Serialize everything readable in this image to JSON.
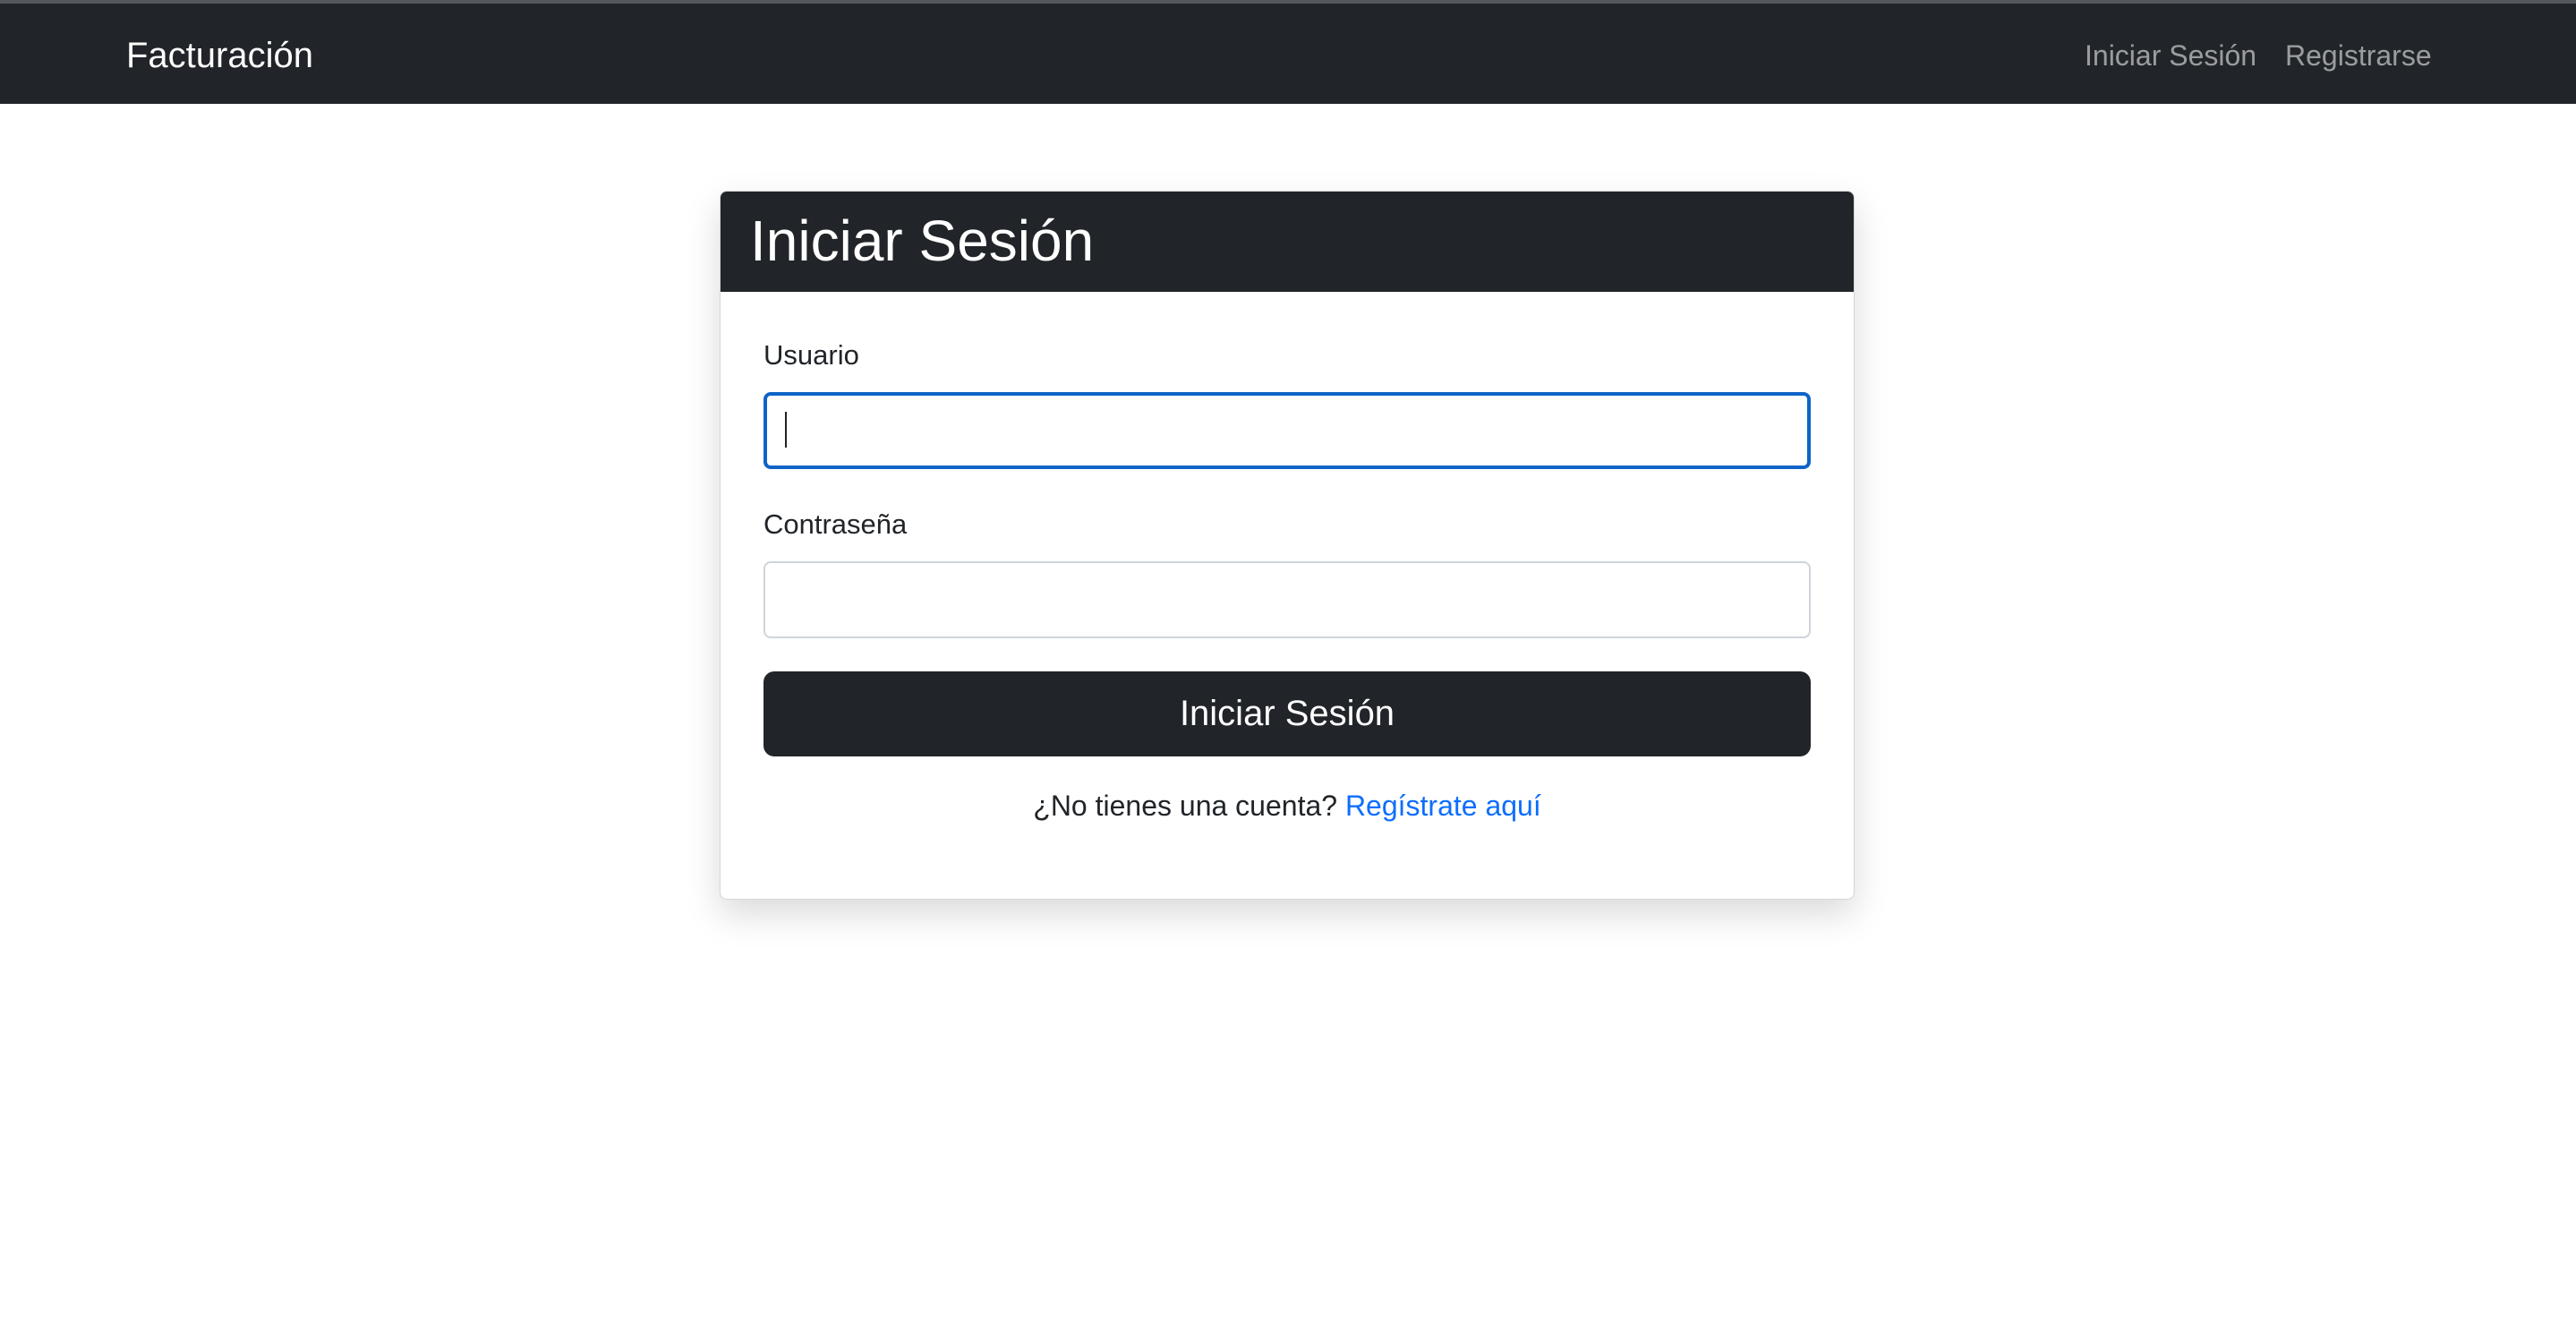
{
  "navbar": {
    "brand": "Facturación",
    "links": [
      {
        "label": "Iniciar Sesión"
      },
      {
        "label": "Registrarse"
      }
    ]
  },
  "login_card": {
    "title": "Iniciar Sesión",
    "username": {
      "label": "Usuario",
      "value": "",
      "placeholder": ""
    },
    "password": {
      "label": "Contraseña",
      "value": "",
      "placeholder": ""
    },
    "submit_label": "Iniciar Sesión",
    "footer_text": "¿No tienes una cuenta?",
    "register_link": "Regístrate aquí"
  },
  "colors": {
    "navbar_bg": "#212529",
    "focus_border": "#0d64c8",
    "link": "#0d6efd"
  }
}
